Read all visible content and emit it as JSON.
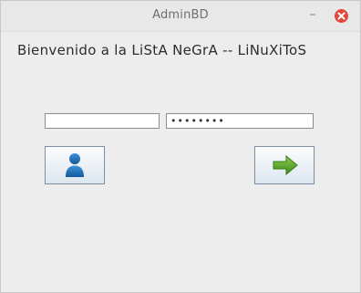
{
  "window": {
    "title": "AdminBD",
    "minimize_label": "–"
  },
  "main": {
    "heading": "Bienvenido a la LiStA NeGrA -- LiNuXiToS",
    "username": {
      "value": "",
      "placeholder": ""
    },
    "password": {
      "value": "••••••••",
      "placeholder": ""
    },
    "buttons": {
      "user_icon": "user-icon",
      "go_icon": "right-arrow-icon"
    }
  },
  "colors": {
    "window_bg": "#ededed",
    "close_button": "#e0483c",
    "user_icon": "#1f6fb5",
    "arrow_icon": "#5aa02c"
  }
}
